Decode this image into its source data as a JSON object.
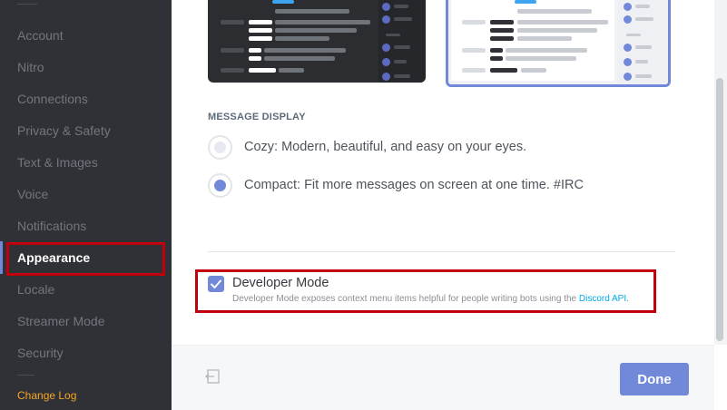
{
  "sidebar": {
    "items": [
      {
        "label": "Account"
      },
      {
        "label": "Nitro"
      },
      {
        "label": "Connections"
      },
      {
        "label": "Privacy & Safety"
      },
      {
        "label": "Text & Images"
      },
      {
        "label": "Voice"
      },
      {
        "label": "Notifications"
      },
      {
        "label": "Appearance",
        "active": true
      },
      {
        "label": "Locale"
      },
      {
        "label": "Streamer Mode"
      },
      {
        "label": "Security"
      }
    ],
    "changelog": "Change Log"
  },
  "message_display": {
    "label": "MESSAGE DISPLAY",
    "options": [
      {
        "label": "Cozy: Modern, beautiful, and easy on your eyes.",
        "selected": false
      },
      {
        "label": "Compact: Fit more messages on screen at one time. #IRC",
        "selected": true
      }
    ]
  },
  "developer_mode": {
    "title": "Developer Mode",
    "checked": true,
    "description": "Developer Mode exposes context menu items helpful for people writing bots using the ",
    "link": "Discord API",
    "suffix": "."
  },
  "footer": {
    "done_label": "Done"
  },
  "colors": {
    "accent": "#7289da",
    "highlight_box": "#c0000b",
    "changelog": "#f5a623",
    "link": "#00a8e8"
  }
}
